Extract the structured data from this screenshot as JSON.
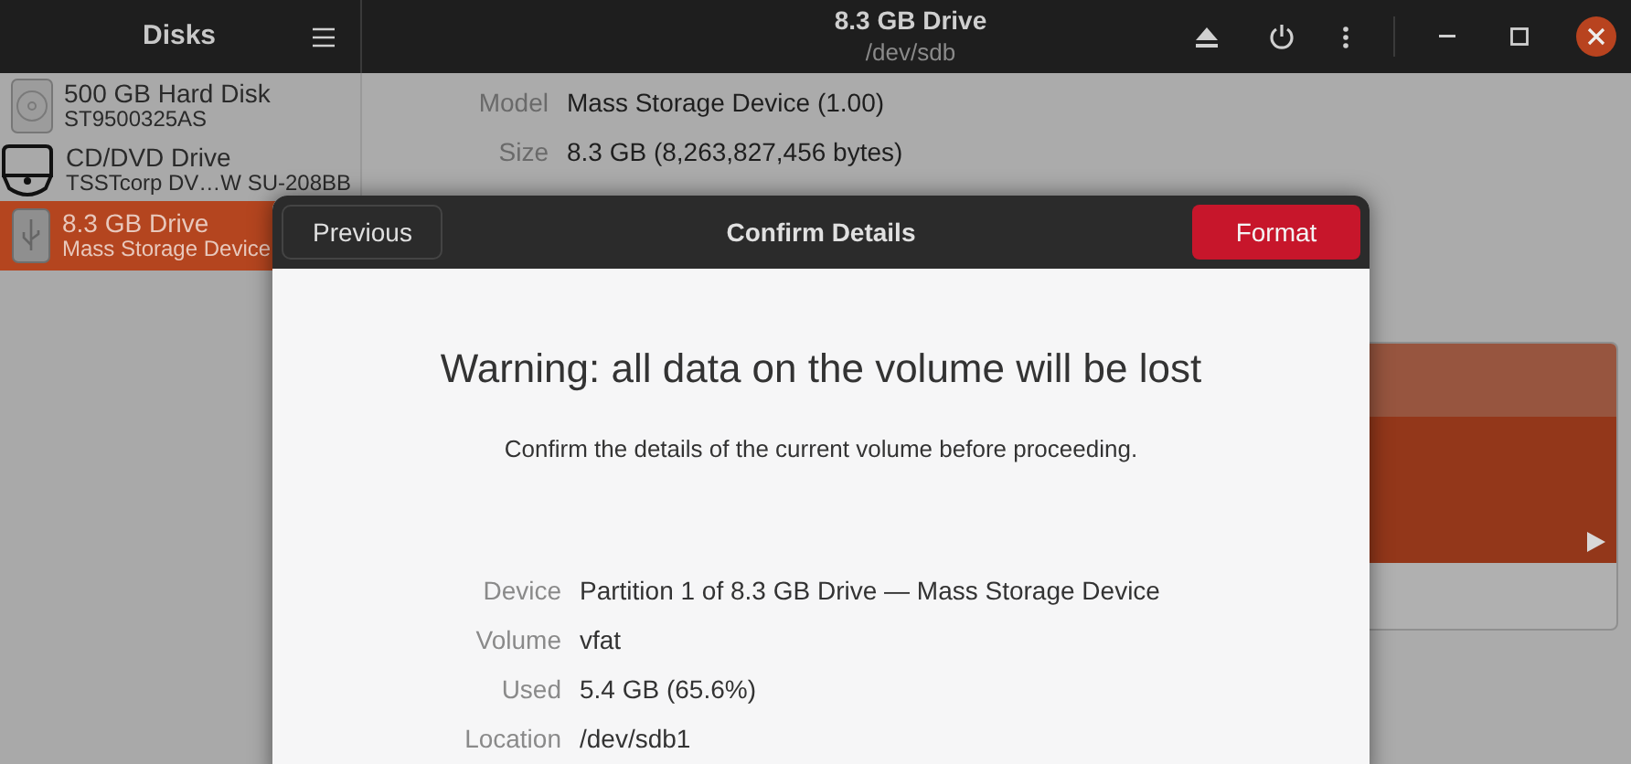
{
  "window": {
    "title": "8.3 GB Drive",
    "subtitle": "/dev/sdb"
  },
  "sidebar": {
    "title": "Disks",
    "items": [
      {
        "name": "500 GB Hard Disk",
        "detail": "ST9500325AS",
        "kind": "hdd",
        "selected": false
      },
      {
        "name": "CD/DVD Drive",
        "detail": "TSSTcorp DV…W SU-208BB",
        "kind": "optical",
        "selected": false
      },
      {
        "name": "8.3 GB Drive",
        "detail": "Mass Storage Device",
        "kind": "usb",
        "selected": true
      }
    ]
  },
  "details": [
    {
      "label": "Model",
      "value": "Mass Storage Device (1.00)"
    },
    {
      "label": "Size",
      "value": "8.3 GB (8,263,827,456 bytes)"
    }
  ],
  "dialog": {
    "title": "Confirm Details",
    "buttons": [
      {
        "label": "Previous",
        "kind": "secondary"
      },
      {
        "label": "Format",
        "kind": "destructive"
      }
    ],
    "heading": "Warning: all data on the volume will be lost",
    "message": "Confirm the details of the current volume before proceeding.",
    "details": [
      {
        "label": "Device",
        "value": "Partition 1 of 8.3 GB Drive — Mass Storage Device"
      },
      {
        "label": "Volume",
        "value": "vfat"
      },
      {
        "label": "Used",
        "value": "5.4 GB (65.6%)"
      },
      {
        "label": "Location",
        "value": "/dev/sdb1"
      }
    ]
  }
}
